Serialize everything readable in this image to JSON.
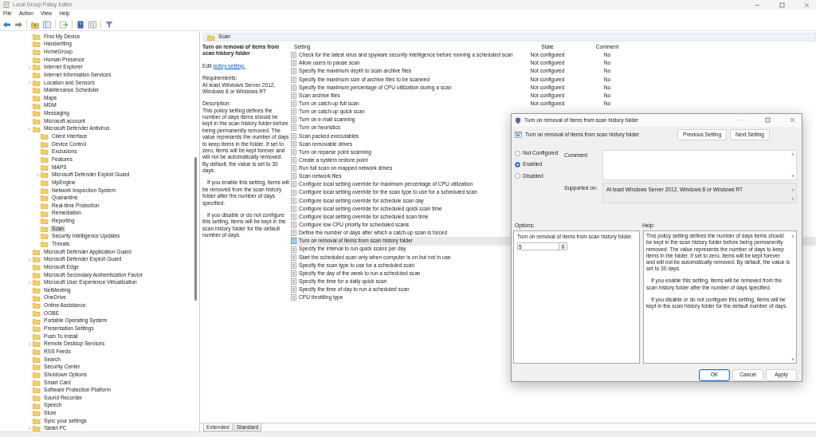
{
  "window": {
    "title": "Local Group Policy Editor"
  },
  "menu": [
    "File",
    "Action",
    "View",
    "Help"
  ],
  "tree": [
    {
      "label": "Find My Device",
      "selected": false
    },
    {
      "label": "Handwriting",
      "selected": false
    },
    {
      "label": "HomeGroup",
      "selected": false
    },
    {
      "label": "Human Presence",
      "selected": false
    },
    {
      "label": "Internet Explorer",
      "selected": false,
      "expanded": false
    },
    {
      "label": "Internet Information Services",
      "selected": false
    },
    {
      "label": "Location and Sensors",
      "selected": false,
      "expanded": false
    },
    {
      "label": "Maintenance Scheduler",
      "selected": false
    },
    {
      "label": "Maps",
      "selected": false
    },
    {
      "label": "MDM",
      "selected": false
    },
    {
      "label": "Messaging",
      "selected": false
    },
    {
      "label": "Microsoft account",
      "selected": false
    },
    {
      "label": "Microsoft Defender Antivirus",
      "selected": false,
      "expanded": true,
      "children": [
        {
          "label": "Client Interface",
          "selected": false
        },
        {
          "label": "Device Control",
          "selected": false
        },
        {
          "label": "Exclusions",
          "selected": false
        },
        {
          "label": "Features",
          "selected": false
        },
        {
          "label": "MAPS",
          "selected": false
        },
        {
          "label": "Microsoft Defender Exploit Guard",
          "selected": false,
          "expanded": false
        },
        {
          "label": "MpEngine",
          "selected": false
        },
        {
          "label": "Network Inspection System",
          "selected": false
        },
        {
          "label": "Quarantine",
          "selected": false
        },
        {
          "label": "Real-time Protection",
          "selected": false
        },
        {
          "label": "Remediation",
          "selected": false
        },
        {
          "label": "Reporting",
          "selected": false
        },
        {
          "label": "Scan",
          "selected": true
        },
        {
          "label": "Security Intelligence Updates",
          "selected": false
        },
        {
          "label": "Threats",
          "selected": false
        }
      ]
    },
    {
      "label": "Microsoft Defender Application Guard",
      "selected": false
    },
    {
      "label": "Microsoft Defender Exploit Guard",
      "selected": false,
      "expanded": false
    },
    {
      "label": "Microsoft Edge",
      "selected": false
    },
    {
      "label": "Microsoft Secondary Authentication Factor",
      "selected": false
    },
    {
      "label": "Microsoft User Experience Virtualization",
      "selected": false,
      "expanded": false
    },
    {
      "label": "NetMeeting",
      "selected": false
    },
    {
      "label": "OneDrive",
      "selected": false
    },
    {
      "label": "Online Assistance",
      "selected": false
    },
    {
      "label": "OOBE",
      "selected": false
    },
    {
      "label": "Portable Operating System",
      "selected": false
    },
    {
      "label": "Presentation Settings",
      "selected": false
    },
    {
      "label": "Push To Install",
      "selected": false
    },
    {
      "label": "Remote Desktop Services",
      "selected": false,
      "expanded": false
    },
    {
      "label": "RSS Feeds",
      "selected": false
    },
    {
      "label": "Search",
      "selected": false
    },
    {
      "label": "Security Center",
      "selected": false
    },
    {
      "label": "Shutdown Options",
      "selected": false
    },
    {
      "label": "Smart Card",
      "selected": false
    },
    {
      "label": "Software Protection Platform",
      "selected": false
    },
    {
      "label": "Sound Recorder",
      "selected": false
    },
    {
      "label": "Speech",
      "selected": false
    },
    {
      "label": "Store",
      "selected": false
    },
    {
      "label": "Sync your settings",
      "selected": false
    },
    {
      "label": "Tablet PC",
      "selected": false,
      "expanded": false
    }
  ],
  "details": {
    "header": "Scan",
    "title": "Turn on removal of items from scan history folder",
    "edit_prefix": "Edit",
    "edit_link": "policy setting.",
    "requirements_label": "Requirements:",
    "requirements": "At least Windows Server 2012, Windows 8 or Windows RT",
    "description_label": "Description:",
    "description": [
      "This policy setting defines the number of days items should be kept in the scan history folder before being permanently removed. The value represents the number of days to keep items in the folder. If set to zero, items will be kept forever and will not be automatically removed. By default, the value is set to 30 days.",
      "If you enable this setting, items will be removed from the scan history folder after the number of days specified.",
      "If you disable or do not configure this setting, items will be kept in the scan history folder for the default number of days."
    ]
  },
  "table": {
    "columns": [
      "Setting",
      "State",
      "Comment"
    ],
    "rows": [
      {
        "setting": "Check for the latest virus and spyware security intelligence before running a scheduled scan",
        "state": "Not configured",
        "comment": "No",
        "selected": false
      },
      {
        "setting": "Allow users to pause scan",
        "state": "Not configured",
        "comment": "No",
        "selected": false
      },
      {
        "setting": "Specify the maximum depth to scan archive files",
        "state": "Not configured",
        "comment": "No",
        "selected": false
      },
      {
        "setting": "Specify the maximum size of archive files to be scanned",
        "state": "Not configured",
        "comment": "No",
        "selected": false
      },
      {
        "setting": "Specify the maximum percentage of CPU utilization during a scan",
        "state": "Not configured",
        "comment": "No",
        "selected": false
      },
      {
        "setting": "Scan archive files",
        "state": "Not configured",
        "comment": "No",
        "selected": false
      },
      {
        "setting": "Turn on catch-up full scan",
        "state": "Not configured",
        "comment": "No",
        "selected": false
      },
      {
        "setting": "Turn on catch-up quick scan",
        "selected": false
      },
      {
        "setting": "Turn on e-mail scanning",
        "selected": false
      },
      {
        "setting": "Turn on heuristics",
        "selected": false
      },
      {
        "setting": "Scan packed executables",
        "selected": false
      },
      {
        "setting": "Scan removable drives",
        "selected": false
      },
      {
        "setting": "Turn on reparse point scanning",
        "selected": false
      },
      {
        "setting": "Create a system restore point",
        "selected": false
      },
      {
        "setting": "Run full scan on mapped network drives",
        "selected": false
      },
      {
        "setting": "Scan network files",
        "selected": false
      },
      {
        "setting": "Configure local setting override for maximum percentage of CPU utilization",
        "selected": false
      },
      {
        "setting": "Configure local setting override for the scan type to use for a scheduled scan",
        "selected": false
      },
      {
        "setting": "Configure local setting override for schedule scan day",
        "selected": false
      },
      {
        "setting": "Configure local setting override for scheduled quick scan time",
        "selected": false
      },
      {
        "setting": "Configure local setting override for scheduled scan time",
        "selected": false
      },
      {
        "setting": "Configure low CPU priority for scheduled scans",
        "selected": false
      },
      {
        "setting": "Define the number of days after which a catch-up scan is forced",
        "selected": false
      },
      {
        "setting": "Turn on removal of items from scan history folder",
        "selected": true
      },
      {
        "setting": "Specify the interval to run quick scans per day",
        "selected": false
      },
      {
        "setting": "Start the scheduled scan only when computer is on but not in use",
        "selected": false
      },
      {
        "setting": "Specify the scan type to use for a scheduled scan",
        "selected": false
      },
      {
        "setting": "Specify the day of the week to run a scheduled scan",
        "selected": false
      },
      {
        "setting": "Specify the time for a daily quick scan",
        "selected": false
      },
      {
        "setting": "Specify the time of day to run a scheduled scan",
        "selected": false
      },
      {
        "setting": "CPU throttling type",
        "selected": false
      }
    ]
  },
  "view_tabs": [
    {
      "label": "Extended",
      "selected": true
    },
    {
      "label": "Standard",
      "selected": false
    }
  ],
  "dialog": {
    "title": "Turn on removal of items from scan history folder",
    "setting_name": "Turn on removal of items from scan history folder",
    "nav_buttons": [
      "Previous Setting",
      "Next Setting"
    ],
    "radios": [
      {
        "label": "Not Configured",
        "selected": false
      },
      {
        "label": "Enabled",
        "selected": true
      },
      {
        "label": "Disabled",
        "selected": false
      }
    ],
    "comment_label": "Comment:",
    "supported_label": "Supported on:",
    "supported": "At least Windows Server 2012, Windows 8 or Windows RT",
    "options_label": "Options:",
    "help_label": "Help:",
    "option": {
      "label": "Turn on removal of items from scan history folder",
      "value": "5"
    },
    "help": [
      "This policy setting defines the number of days items should be kept in the scan history folder before being permanently removed. The value represents the number of days to keep items in the folder. If set to zero, items will be kept forever and will not be automatically removed. By default, the value is set to 30 days.",
      "If you enable this setting, items will be removed from the scan history folder after the number of days specified.",
      "If you disable or do not configure this setting, items will be kept in the scan history folder for the default number of days."
    ],
    "buttons": [
      {
        "label": "OK",
        "default": true
      },
      {
        "label": "Cancel",
        "default": false
      },
      {
        "label": "Apply",
        "default": false
      }
    ]
  }
}
